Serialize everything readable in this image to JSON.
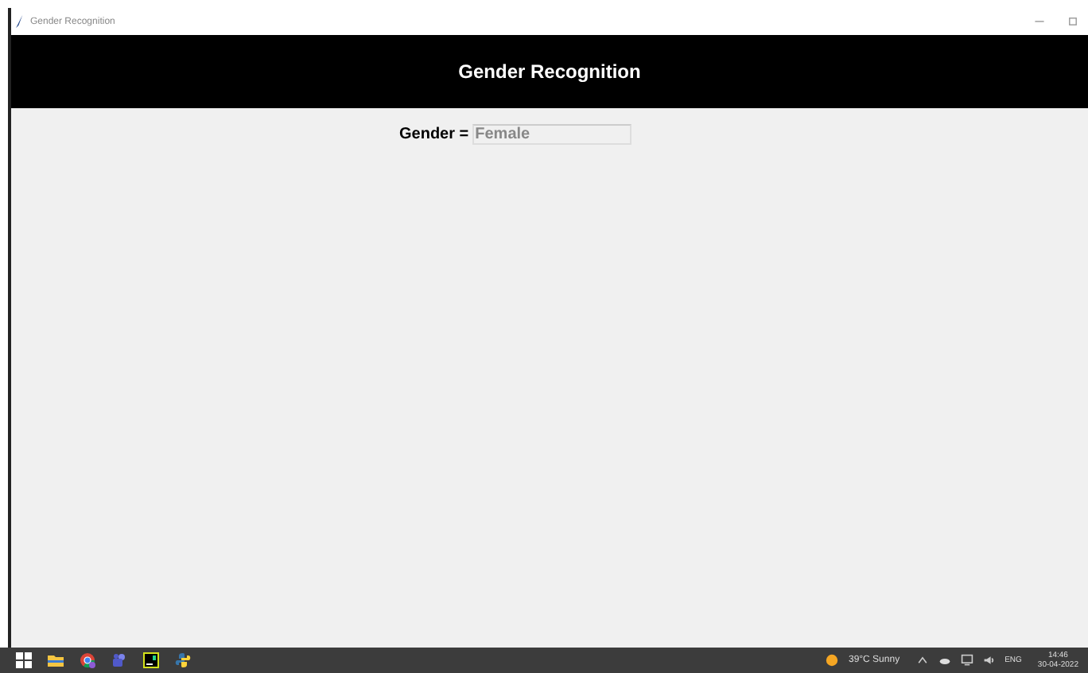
{
  "window": {
    "title": "Gender Recognition"
  },
  "header": {
    "title": "Gender Recognition"
  },
  "result": {
    "label": "Gender =",
    "value": "Female",
    "disabled": true
  },
  "taskbar": {
    "weather": "39°C Sunny",
    "language": "ENG",
    "time": "14:46",
    "date": "30-04-2022"
  }
}
